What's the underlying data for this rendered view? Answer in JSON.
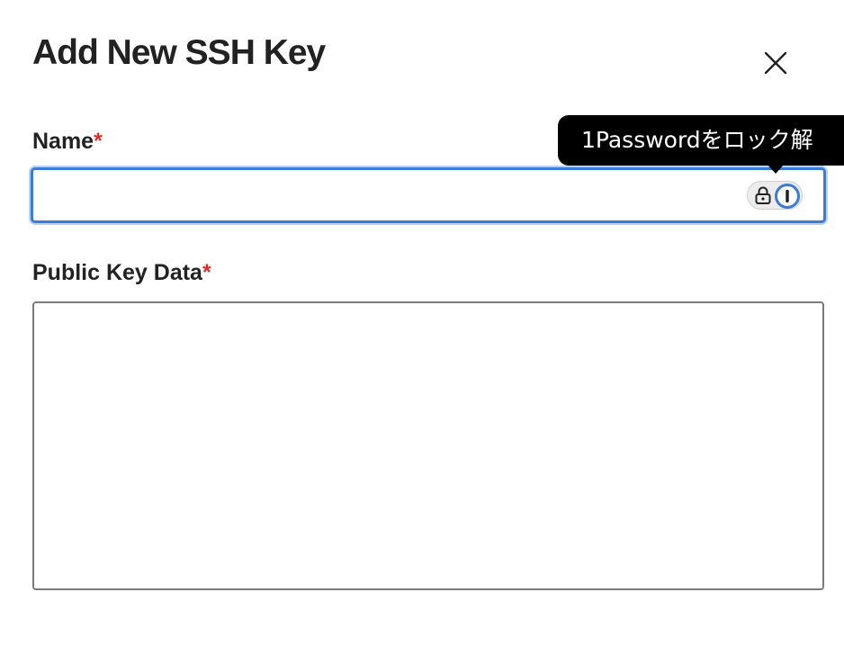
{
  "dialog": {
    "title": "Add New SSH Key",
    "close_icon": "close-x-icon"
  },
  "fields": {
    "name": {
      "label": "Name",
      "required_marker": "*",
      "value": "",
      "placeholder": ""
    },
    "public_key": {
      "label": "Public Key Data",
      "required_marker": "*",
      "value": "",
      "placeholder": ""
    }
  },
  "password_manager": {
    "tooltip": "1Passwordをロック解",
    "lock_icon": "lock-icon",
    "logo_icon": "1password-logo-icon"
  },
  "colors": {
    "focus_ring": "#3a7ad8",
    "required": "#d93025",
    "tooltip_bg": "#000000"
  }
}
